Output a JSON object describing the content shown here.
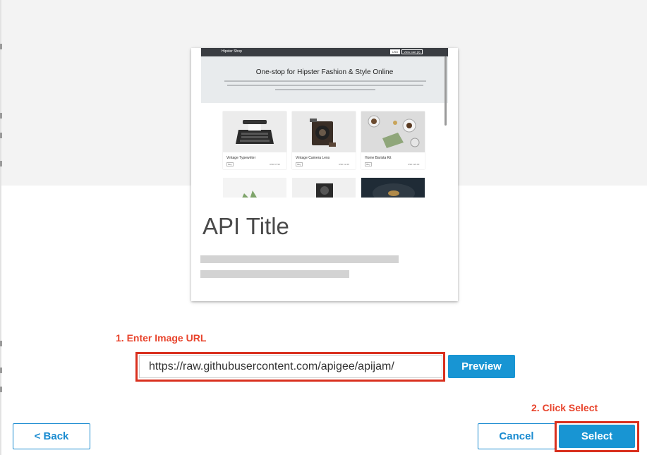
{
  "colors": {
    "accent": "#1895d3",
    "annotation": "#e8432b",
    "highlight_border": "#d9301e",
    "background_band": "#f3f3f3"
  },
  "preview_card": {
    "thumbnail": {
      "nav_brand": "Hipster Shop",
      "currency": "USD",
      "cart": "View Cart (0)",
      "headline": "One-stop for Hipster Fashion & Style Online",
      "products": [
        {
          "name": "Vintage Typewriter",
          "buy": "Buy",
          "price": "USD 67.99"
        },
        {
          "name": "Vintage Camera Lens",
          "buy": "Buy",
          "price": "USD 12.49"
        },
        {
          "name": "Home Barista Kit",
          "buy": "Buy",
          "price": "USD 124.00"
        }
      ]
    },
    "title": "API Title"
  },
  "annotations": {
    "step1": "1. Enter Image URL",
    "step2": "2. Click Select"
  },
  "url_field": {
    "value": "https://raw.githubusercontent.com/apigee/apijam/"
  },
  "buttons": {
    "preview": "Preview",
    "back": "< Back",
    "cancel": "Cancel",
    "select": "Select"
  }
}
